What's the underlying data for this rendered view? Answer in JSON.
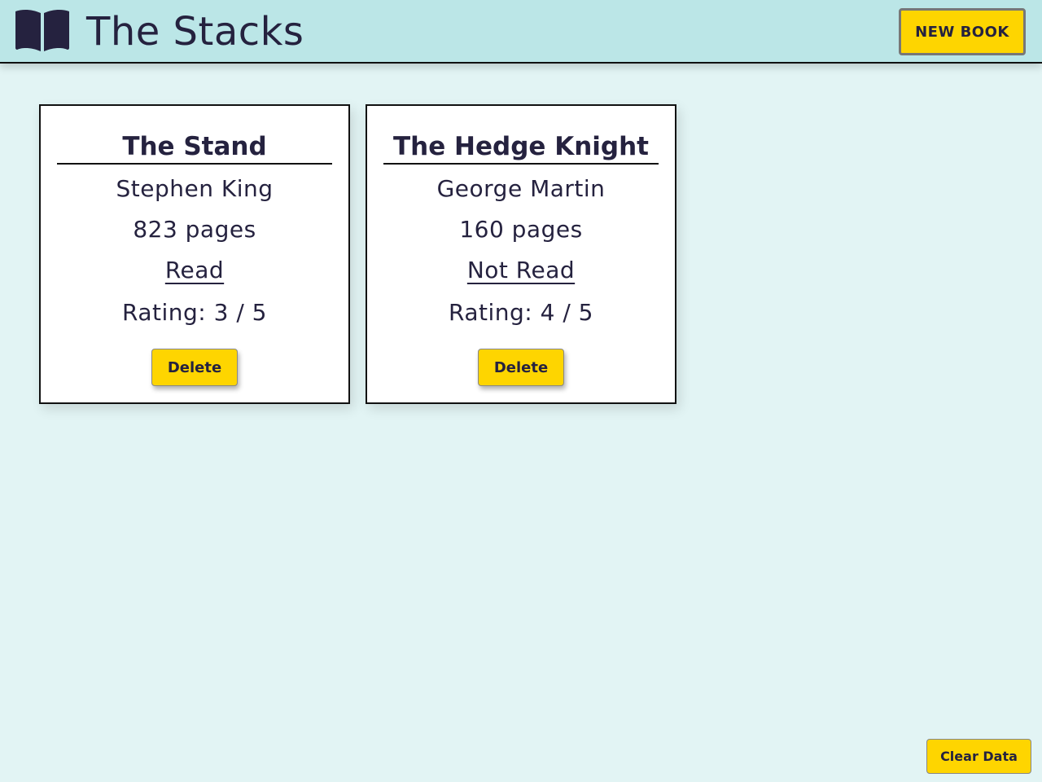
{
  "header": {
    "title": "The Stacks",
    "logo_icon": "open-book-icon",
    "new_book_label": "NEW BOOK"
  },
  "books": [
    {
      "title": "The Stand",
      "author": "Stephen King",
      "pages": "823 pages",
      "status": "Read",
      "rating": "Rating: 3 / 5",
      "delete_label": "Delete"
    },
    {
      "title": "The Hedge Knight",
      "author": "George Martin",
      "pages": "160 pages",
      "status": "Not Read",
      "rating": "Rating: 4 / 5",
      "delete_label": "Delete"
    }
  ],
  "footer": {
    "clear_label": "Clear Data"
  },
  "colors": {
    "background": "#e2f4f4",
    "header": "#bbe6e7",
    "accent": "#fed500",
    "text": "#25223f"
  }
}
